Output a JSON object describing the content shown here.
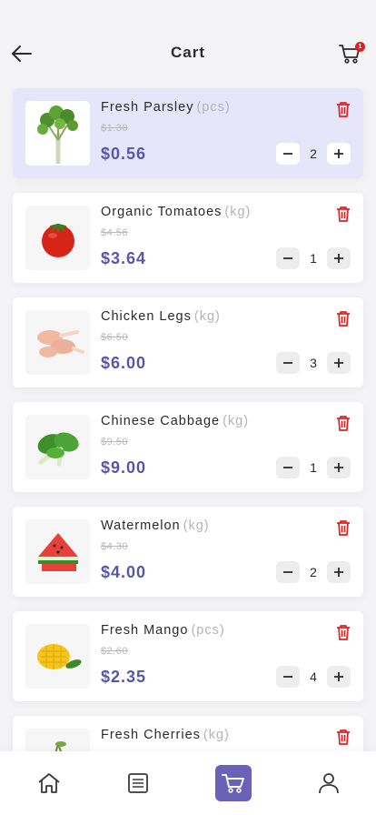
{
  "header": {
    "title": "Cart",
    "cart_badge": "1"
  },
  "colors": {
    "accent": "#6a62b6",
    "price": "#5a55a6",
    "delete": "#e02020",
    "active_card": "#e6e5fa"
  },
  "items": [
    {
      "name": "Fresh Parsley",
      "unit": "(pcs)",
      "old_price": "$1.30",
      "price": "$0.56",
      "qty": "2",
      "image": "parsley-image"
    },
    {
      "name": "Organic Tomatoes",
      "unit": "(kg)",
      "old_price": "$4.56",
      "price": "$3.64",
      "qty": "1",
      "image": "tomato-image"
    },
    {
      "name": "Chicken Legs",
      "unit": "(kg)",
      "old_price": "$6.50",
      "price": "$6.00",
      "qty": "3",
      "image": "chicken-legs-image"
    },
    {
      "name": "Chinese Cabbage",
      "unit": "(kg)",
      "old_price": "$9.50",
      "price": "$9.00",
      "qty": "1",
      "image": "cabbage-image"
    },
    {
      "name": "Watermelon",
      "unit": "(kg)",
      "old_price": "$4.30",
      "price": "$4.00",
      "qty": "2",
      "image": "watermelon-image"
    },
    {
      "name": "Fresh Mango",
      "unit": "(pcs)",
      "old_price": "$2.60",
      "price": "$2.35",
      "qty": "4",
      "image": "mango-image"
    },
    {
      "name": "Fresh Cherries",
      "unit": "(kg)",
      "old_price": "",
      "price": "",
      "qty": "",
      "image": "cherries-image"
    }
  ],
  "tabs": [
    {
      "name": "home",
      "icon": "home-icon"
    },
    {
      "name": "orders",
      "icon": "list-icon"
    },
    {
      "name": "cart",
      "icon": "cart-icon",
      "active": true
    },
    {
      "name": "profile",
      "icon": "user-icon"
    }
  ]
}
